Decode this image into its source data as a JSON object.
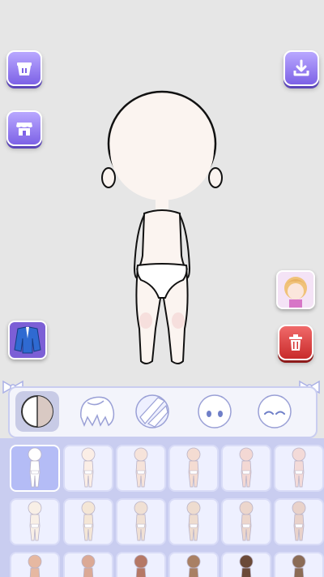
{
  "app": {
    "screen": "character-editor"
  },
  "toolbar": {
    "top_left_button": "shop",
    "left_button_2": "store",
    "top_right_button": "download",
    "outfit_thumb": "jacket",
    "avatar_thumb": "character-portrait",
    "delete_button": "trash"
  },
  "colors": {
    "accent": "#7d62e6",
    "panel": "#c9cdf0",
    "tile_bg": "#eef0ff",
    "danger": "#d53333",
    "skin": "#fbf4f0"
  },
  "categories": [
    {
      "name": "body-skin",
      "active": true
    },
    {
      "name": "hair-back",
      "active": false
    },
    {
      "name": "hair-front",
      "active": false
    },
    {
      "name": "eyes",
      "active": false
    },
    {
      "name": "face-expression",
      "active": false
    }
  ],
  "skin_tones": [
    "#ffffff",
    "#fbeee6",
    "#f6e3da",
    "#f4dcd2",
    "#f3d8d4",
    "#f3dad8",
    "#f8efe6",
    "#f4e6d6",
    "#f0e0d4",
    "#eedccf",
    "#ecd6cc",
    "#e9d2ca",
    "#e6b8a1",
    "#dba995",
    "#b57866",
    "#a98064",
    "#6b4a38",
    "#8b6c56"
  ],
  "selected_tone_index": 0
}
